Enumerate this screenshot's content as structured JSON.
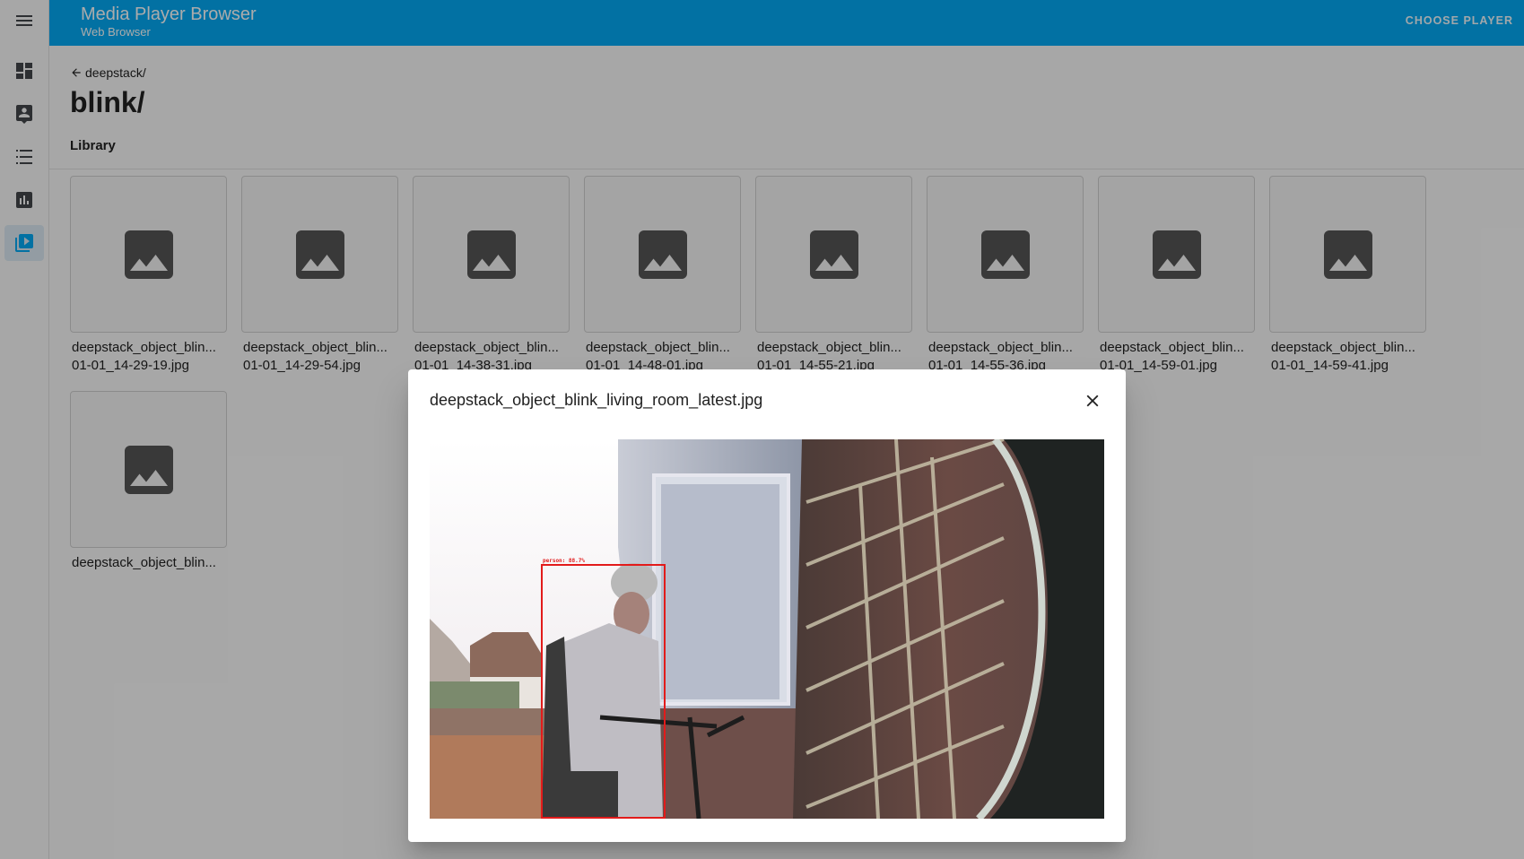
{
  "app": {
    "title": "Media Player Browser",
    "subtitle": "Web Browser",
    "choose_player": "CHOOSE PLAYER",
    "accent": "#03a9f4"
  },
  "sidebar": {
    "items": [
      {
        "name": "menu-icon"
      },
      {
        "name": "dashboard-icon"
      },
      {
        "name": "map-icon"
      },
      {
        "name": "logbook-icon"
      },
      {
        "name": "history-icon"
      },
      {
        "name": "media-icon",
        "active": true
      }
    ]
  },
  "breadcrumb": {
    "back_label": "deepstack/"
  },
  "page": {
    "title": "blink/",
    "section": "Library"
  },
  "tiles": [
    {
      "line1": "deepstack_object_blin...",
      "line2": "01-01_14-29-19.jpg"
    },
    {
      "line1": "deepstack_object_blin...",
      "line2": "01-01_14-29-54.jpg"
    },
    {
      "line1": "deepstack_object_blin...",
      "line2": "01-01_14-38-31.jpg"
    },
    {
      "line1": "deepstack_object_blin...",
      "line2": "01-01_14-48-01.jpg"
    },
    {
      "line1": "deepstack_object_blin...",
      "line2": "01-01_14-55-21.jpg"
    },
    {
      "line1": "deepstack_object_blin...",
      "line2": "01-01_14-55-36.jpg"
    },
    {
      "line1": "deepstack_object_blin...",
      "line2": "01-01_14-59-01.jpg"
    },
    {
      "line1": "deepstack_object_blin...",
      "line2": "01-01_14-59-41.jpg"
    },
    {
      "line1": "deepstack_object_blin...",
      "line2": ""
    }
  ],
  "dialog": {
    "title": "deepstack_object_blink_living_room_latest.jpg",
    "detection_label": "person: 88.7%"
  }
}
